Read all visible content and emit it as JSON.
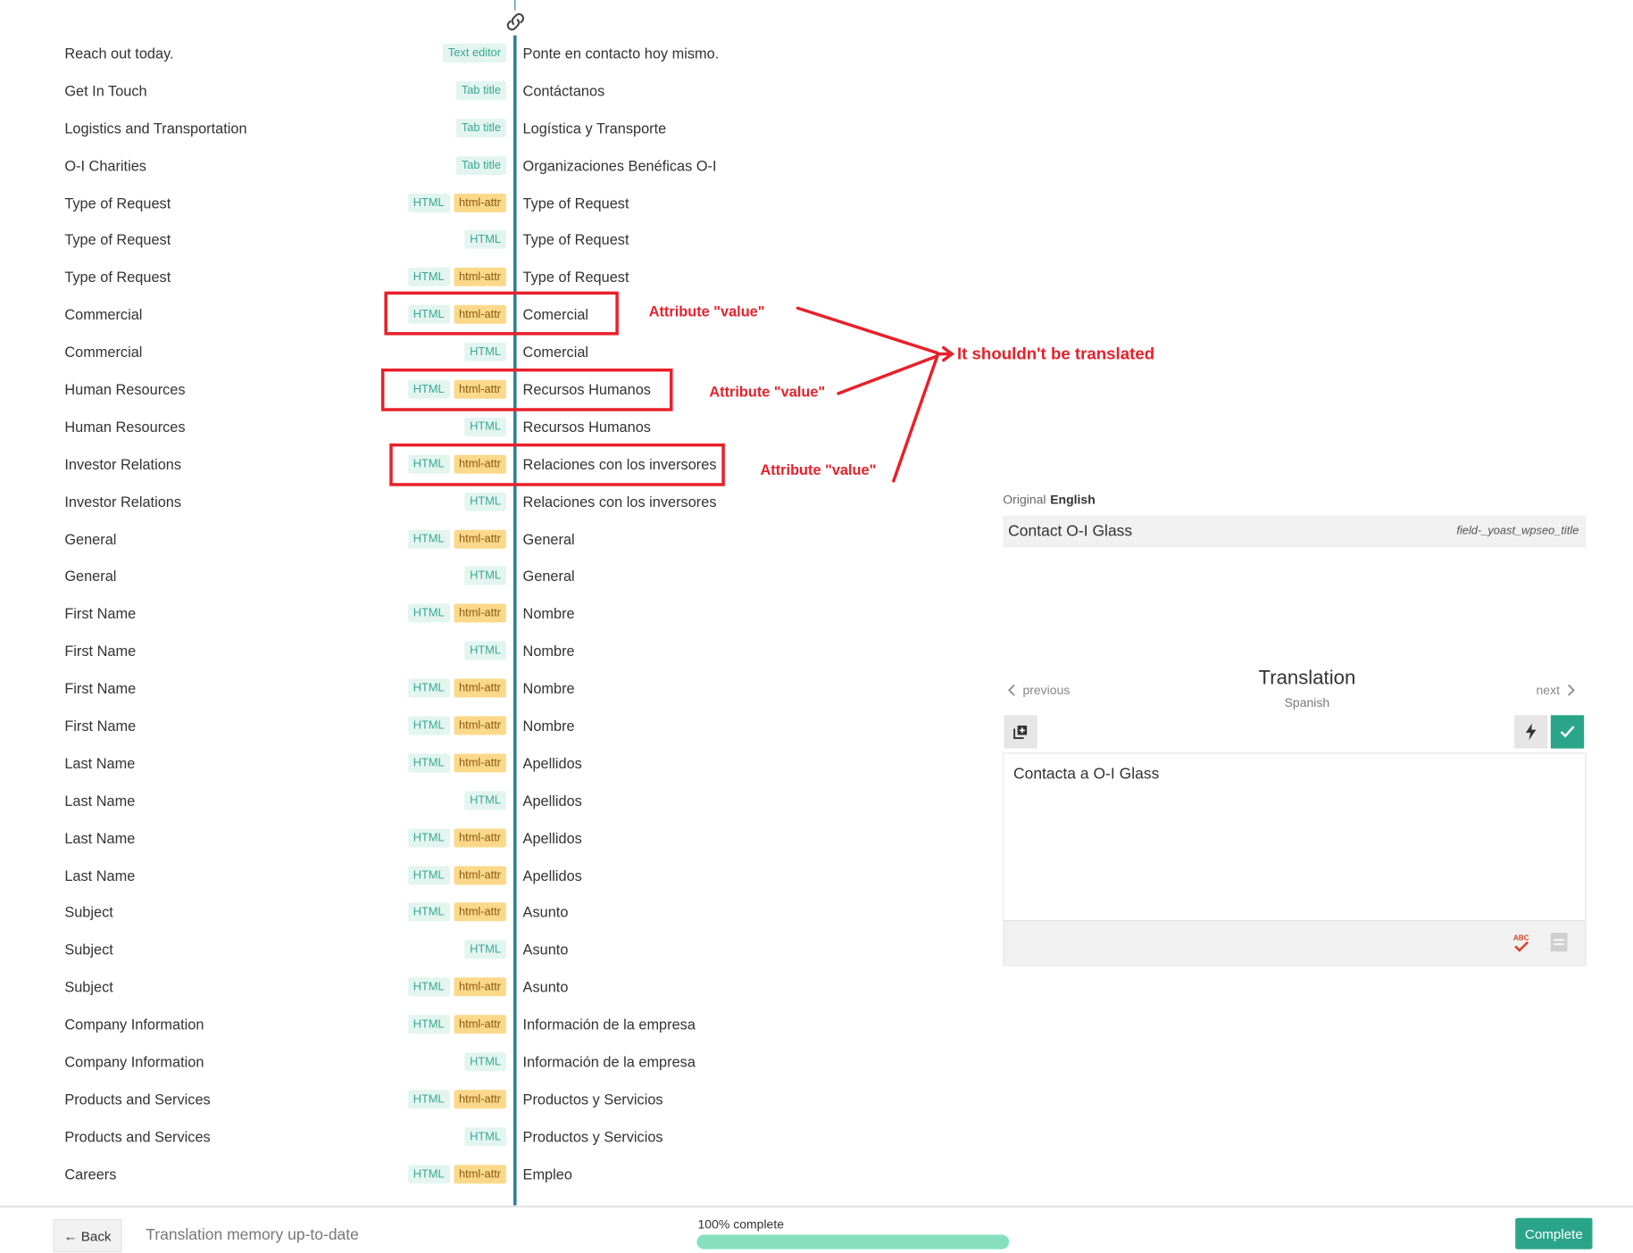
{
  "rows": [
    {
      "source": "Reach out today.",
      "tags": [
        "Text editor"
      ],
      "target": "Ponte en contacto hoy mismo."
    },
    {
      "source": "Get In Touch",
      "tags": [
        "Tab title"
      ],
      "target": "Contáctanos"
    },
    {
      "source": "Logistics and Transportation",
      "tags": [
        "Tab title"
      ],
      "target": "Logística y Transporte"
    },
    {
      "source": "O-I Charities",
      "tags": [
        "Tab title"
      ],
      "target": "Organizaciones Benéficas O-I"
    },
    {
      "source": "Type of Request",
      "tags": [
        "HTML",
        "html-attr"
      ],
      "target": "Type of Request"
    },
    {
      "source": "Type of Request",
      "tags": [
        "HTML"
      ],
      "target": "Type of Request"
    },
    {
      "source": "Type of Request",
      "tags": [
        "HTML",
        "html-attr"
      ],
      "target": "Type of Request"
    },
    {
      "source": "Commercial",
      "tags": [
        "HTML",
        "html-attr"
      ],
      "target": "Comercial"
    },
    {
      "source": "Commercial",
      "tags": [
        "HTML"
      ],
      "target": "Comercial"
    },
    {
      "source": "Human Resources",
      "tags": [
        "HTML",
        "html-attr"
      ],
      "target": "Recursos Humanos"
    },
    {
      "source": "Human Resources",
      "tags": [
        "HTML"
      ],
      "target": "Recursos Humanos"
    },
    {
      "source": "Investor Relations",
      "tags": [
        "HTML",
        "html-attr"
      ],
      "target": "Relaciones con los inversores"
    },
    {
      "source": "Investor Relations",
      "tags": [
        "HTML"
      ],
      "target": "Relaciones con los inversores"
    },
    {
      "source": "General",
      "tags": [
        "HTML",
        "html-attr"
      ],
      "target": "General"
    },
    {
      "source": "General",
      "tags": [
        "HTML"
      ],
      "target": "General"
    },
    {
      "source": "First Name",
      "tags": [
        "HTML",
        "html-attr"
      ],
      "target": "Nombre"
    },
    {
      "source": "First Name",
      "tags": [
        "HTML"
      ],
      "target": "Nombre"
    },
    {
      "source": "First Name",
      "tags": [
        "HTML",
        "html-attr"
      ],
      "target": "Nombre"
    },
    {
      "source": "First Name",
      "tags": [
        "HTML",
        "html-attr"
      ],
      "target": "Nombre"
    },
    {
      "source": "Last Name",
      "tags": [
        "HTML",
        "html-attr"
      ],
      "target": "Apellidos"
    },
    {
      "source": "Last Name",
      "tags": [
        "HTML"
      ],
      "target": "Apellidos"
    },
    {
      "source": "Last Name",
      "tags": [
        "HTML",
        "html-attr"
      ],
      "target": "Apellidos"
    },
    {
      "source": "Last Name",
      "tags": [
        "HTML",
        "html-attr"
      ],
      "target": "Apellidos"
    },
    {
      "source": "Subject",
      "tags": [
        "HTML",
        "html-attr"
      ],
      "target": "Asunto"
    },
    {
      "source": "Subject",
      "tags": [
        "HTML"
      ],
      "target": "Asunto"
    },
    {
      "source": "Subject",
      "tags": [
        "HTML",
        "html-attr"
      ],
      "target": "Asunto"
    },
    {
      "source": "Company Information",
      "tags": [
        "HTML",
        "html-attr"
      ],
      "target": "Información de la empresa"
    },
    {
      "source": "Company Information",
      "tags": [
        "HTML"
      ],
      "target": "Información de la empresa"
    },
    {
      "source": "Products and Services",
      "tags": [
        "HTML",
        "html-attr"
      ],
      "target": "Productos y Servicios"
    },
    {
      "source": "Products and Services",
      "tags": [
        "HTML"
      ],
      "target": "Productos y Servicios"
    },
    {
      "source": "Careers",
      "tags": [
        "HTML",
        "html-attr"
      ],
      "target": "Empleo"
    }
  ],
  "annotations": {
    "attr_label_1": "Attribute \"value\"",
    "attr_label_2": "Attribute \"value\"",
    "attr_label_3": "Attribute \"value\"",
    "main_note": "It shouldn't be translated",
    "color": "#e8202a"
  },
  "editor": {
    "original_label": "Original",
    "original_language": "English",
    "original_text": "Contact O-I Glass",
    "field_name": "field-_yoast_wpseo_title",
    "previous_label": "previous",
    "next_label": "next",
    "translation_title": "Translation",
    "translation_language": "Spanish",
    "translation_text": "Contacta a O-I Glass",
    "icons": {
      "copy": "copy-original-icon",
      "machine_translate": "lightning-icon",
      "confirm": "check-icon",
      "spellcheck": "spellcheck-icon",
      "glossary": "glossary-icon"
    }
  },
  "bottom_bar": {
    "back_label": "← Back",
    "tm_status": "Translation memory up-to-date",
    "progress_label": "100% complete",
    "progress_value": 1.0,
    "complete_label": "Complete"
  },
  "colors": {
    "accent": "#2aa58a",
    "divider": "#2e7d96",
    "tag_html_bg": "#e3f5ef",
    "tag_attr_bg": "#fcd98a"
  }
}
